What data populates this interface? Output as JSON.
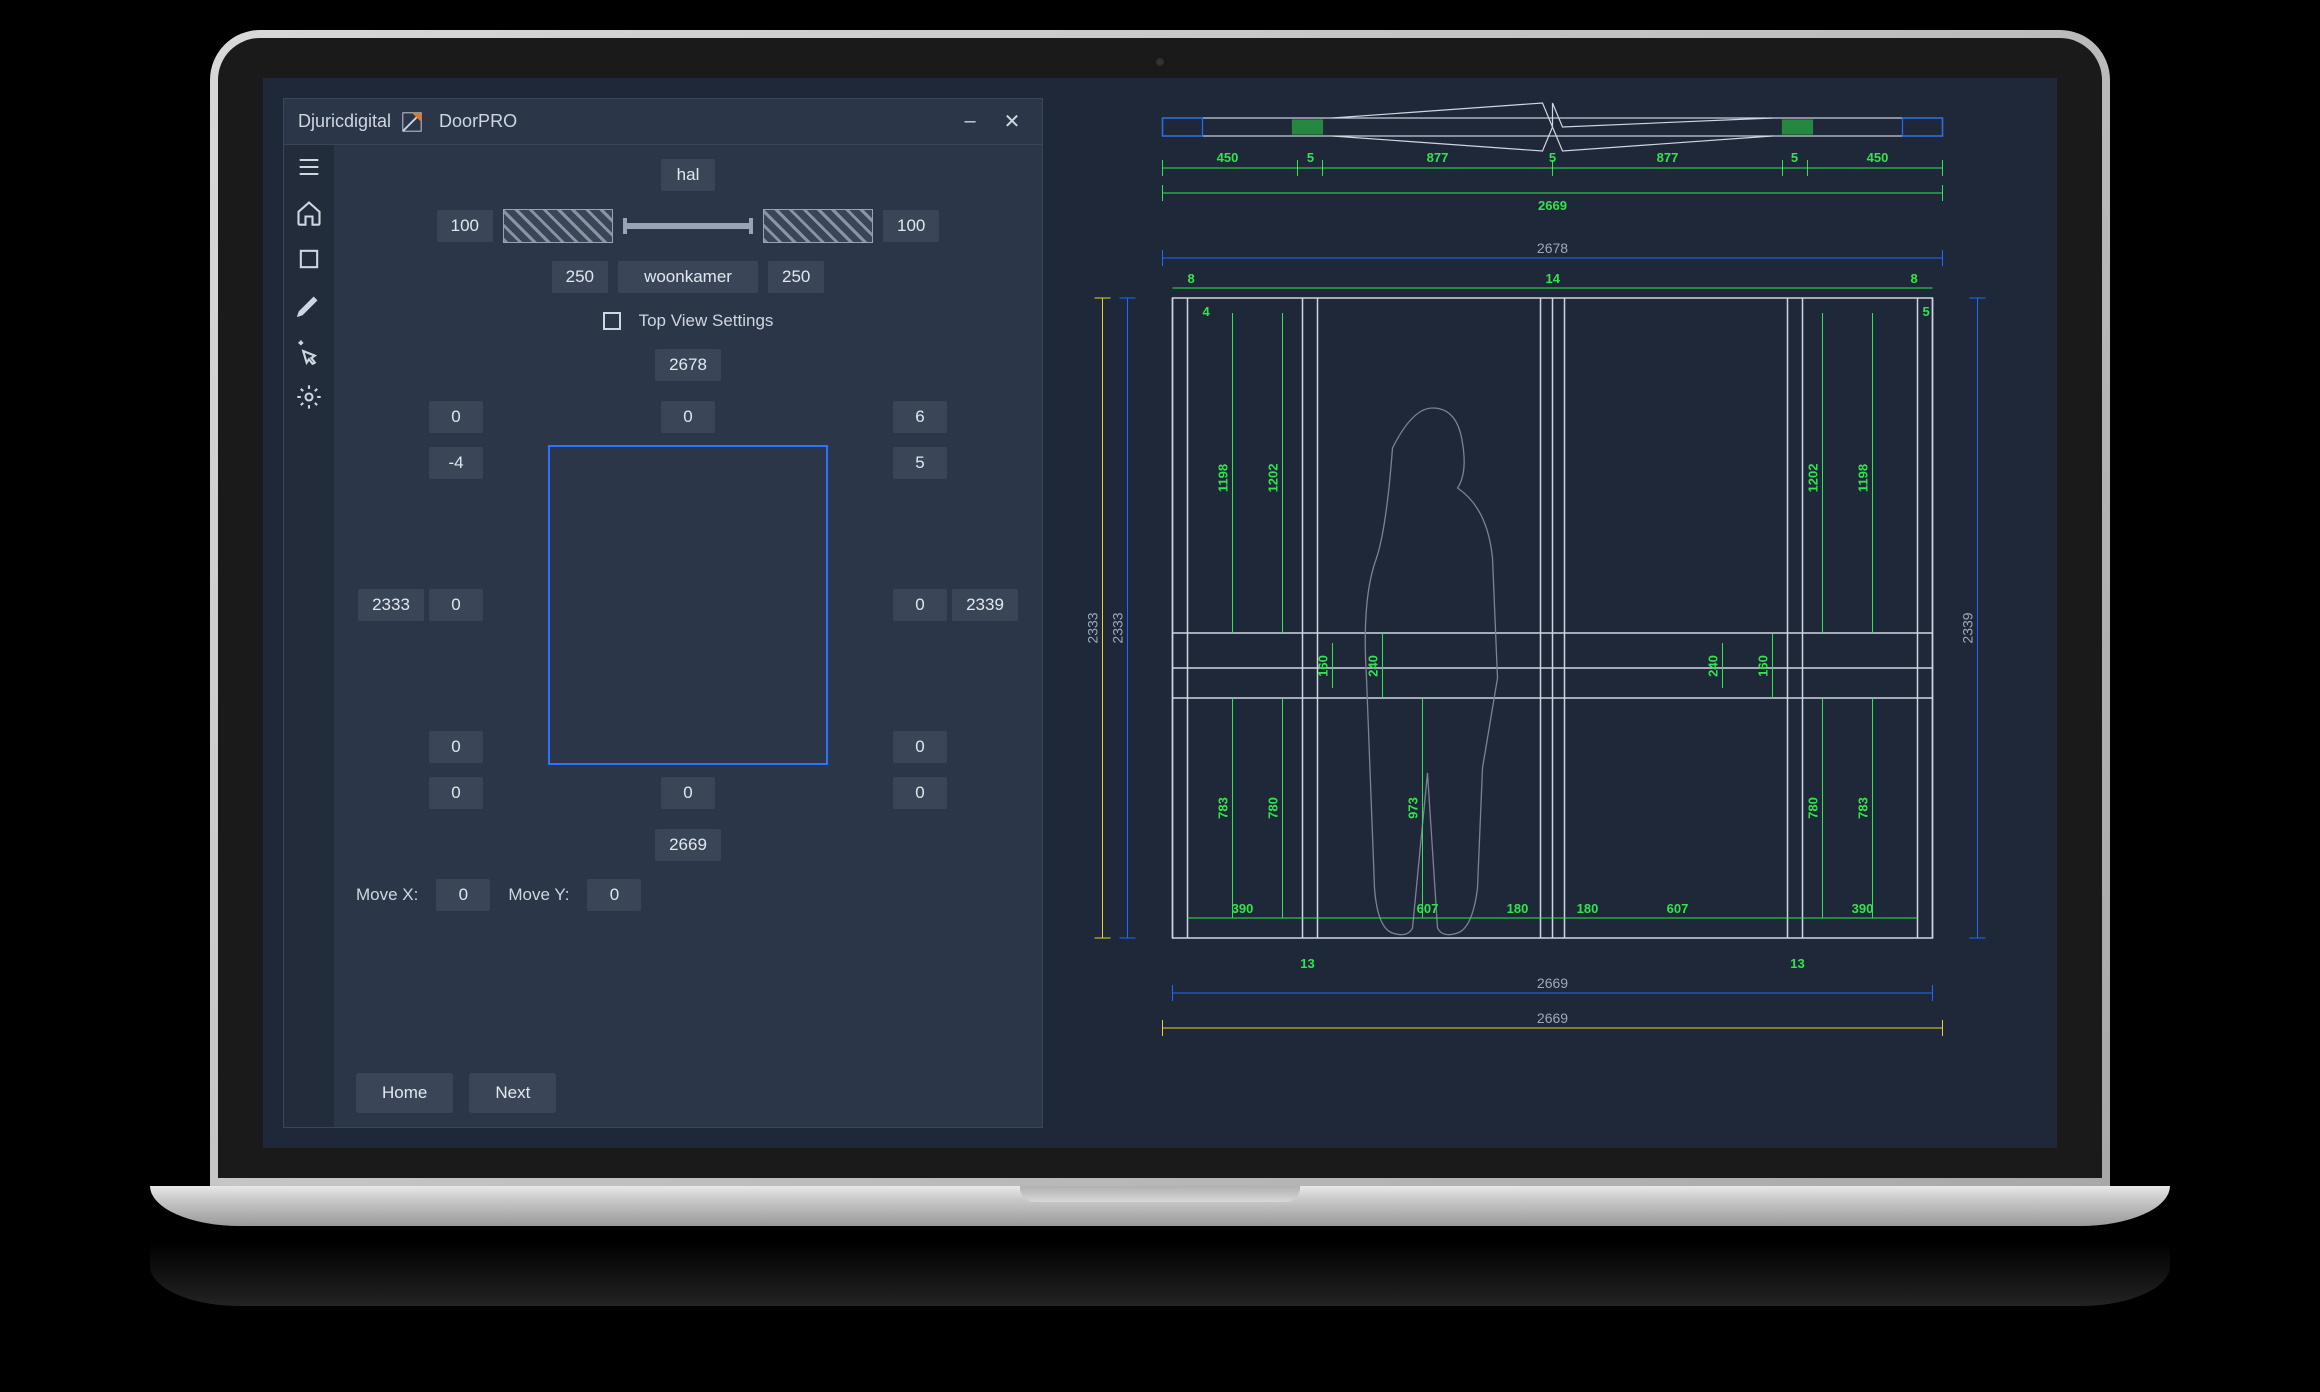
{
  "window": {
    "brand": "Djuricdigital",
    "app": "DoorPRO",
    "minimize": "–",
    "close": "✕"
  },
  "sidebar_icons": [
    "list-icon",
    "home-icon",
    "crop-icon",
    "pencil-icon",
    "cursor-click-icon",
    "gear-icon"
  ],
  "top_section": {
    "hal": "hal",
    "left_100": "100",
    "right_100": "100",
    "left_250": "250",
    "woonkamer": "woonkamer",
    "right_250": "250",
    "checkbox_label": "Top View Settings"
  },
  "sketch": {
    "top_width": "2678",
    "top_left": "0",
    "top_mid": "0",
    "top_right": "6",
    "upper_left": "-4",
    "upper_right": "5",
    "mid_left_outer": "2333",
    "mid_left_inner": "0",
    "mid_right_inner": "0",
    "mid_right_outer": "2339",
    "lower_left": "0",
    "lower_right": "0",
    "bot_left": "0",
    "bot_mid": "0",
    "bot_right": "0",
    "bot_width": "2669"
  },
  "move": {
    "x_label": "Move X:",
    "x_val": "0",
    "y_label": "Move Y:",
    "y_val": "0"
  },
  "buttons": {
    "home": "Home",
    "next": "Next"
  },
  "cad": {
    "top_plan": {
      "d1": "450",
      "d2": "5",
      "d3": "877",
      "d4": "5",
      "d5": "877",
      "d6": "5",
      "d7": "450",
      "total": "2669"
    },
    "elevation": {
      "overall_w": "2678",
      "t_left": "8",
      "t_right": "8",
      "t_mid": "14",
      "tl_in": "4",
      "tr_in": "5",
      "h_left_outer": "2333",
      "h_left_inner": "2333",
      "h_right": "2339",
      "col_up_out": "1198",
      "col_up_in": "1202",
      "mid_h_out": "160",
      "mid_h_in": "240",
      "mid_h_gap": "973",
      "col_lo_out": "783",
      "col_lo_in": "780",
      "base_out": "390",
      "base_in": "607",
      "base_mid": "180",
      "bottom_off": "13",
      "footer1": "2669",
      "footer2": "2669"
    }
  }
}
